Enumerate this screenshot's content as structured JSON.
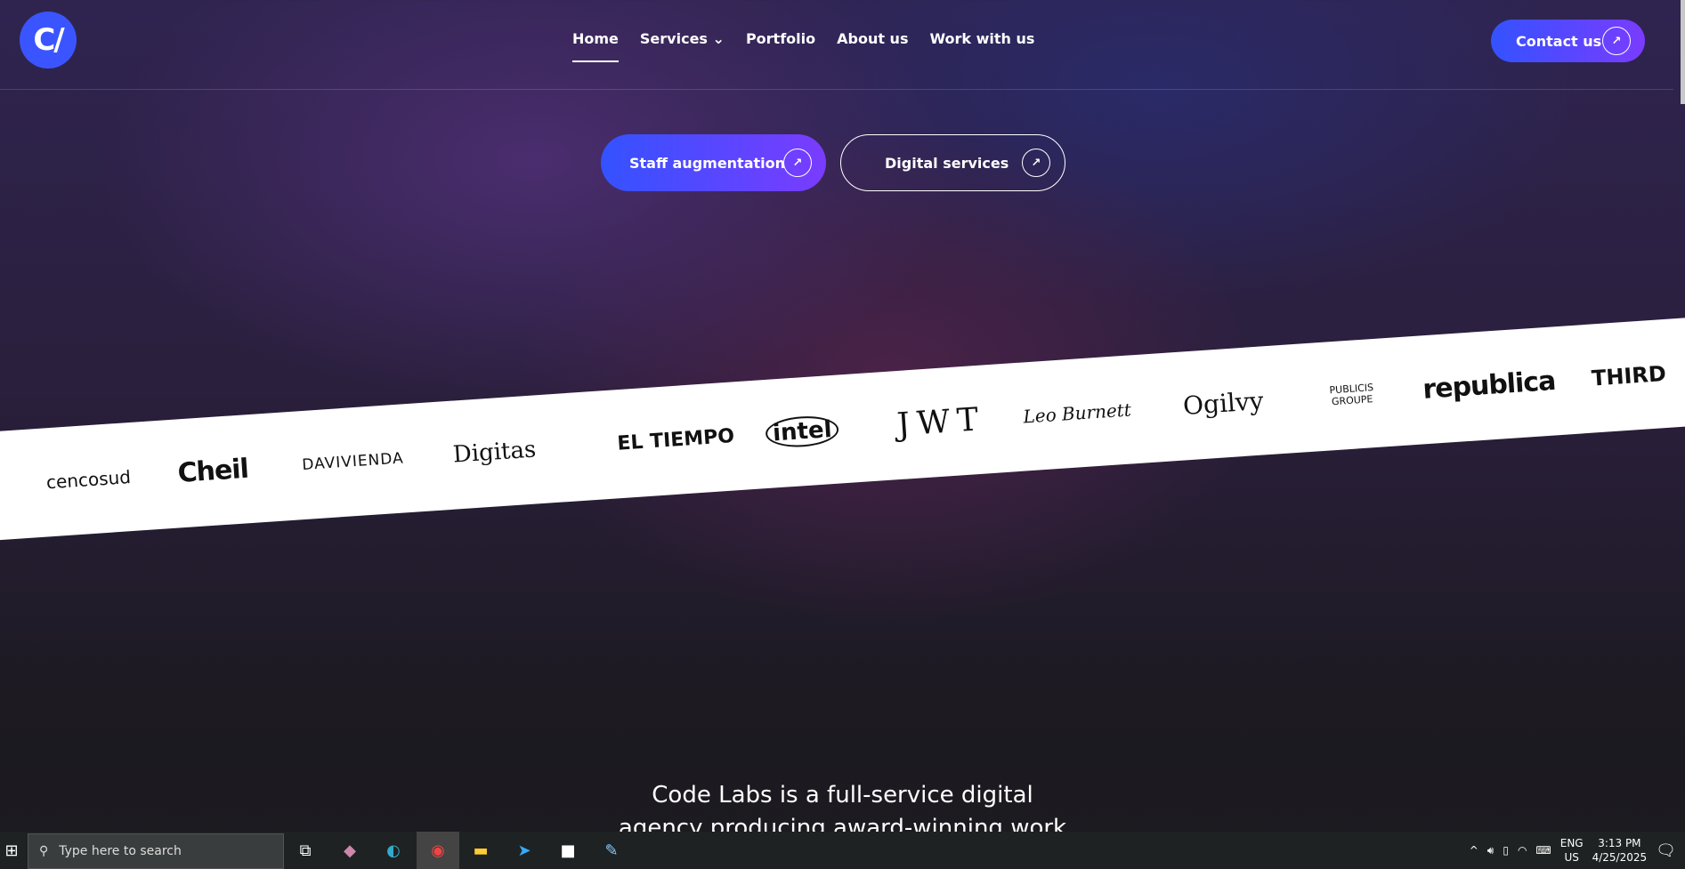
{
  "nav": {
    "logo": "C/",
    "items": [
      "Home",
      "Services",
      "Portfolio",
      "About us",
      "Work with us"
    ],
    "contact": "Contact us"
  },
  "hero": {
    "staff": "Staff augmentation",
    "digital": "Digital services",
    "arrow": "↗"
  },
  "clients": [
    "cencosud",
    "Cheil",
    "DAVIVIENDA",
    "Digitas",
    "EL TIEMPO",
    "intel",
    "JWT",
    "Leo Burnett",
    "Ogilvy",
    "PUBLICIS GROUPE",
    "republica",
    "THIRD"
  ],
  "headline": [
    "Code Labs is a full-service digital",
    "agency producing award-winning work"
  ],
  "taskbar": {
    "search": "Type here to search",
    "lang": "ENG",
    "region": "US",
    "time": "3:13 PM",
    "date": "4/25/2025"
  }
}
